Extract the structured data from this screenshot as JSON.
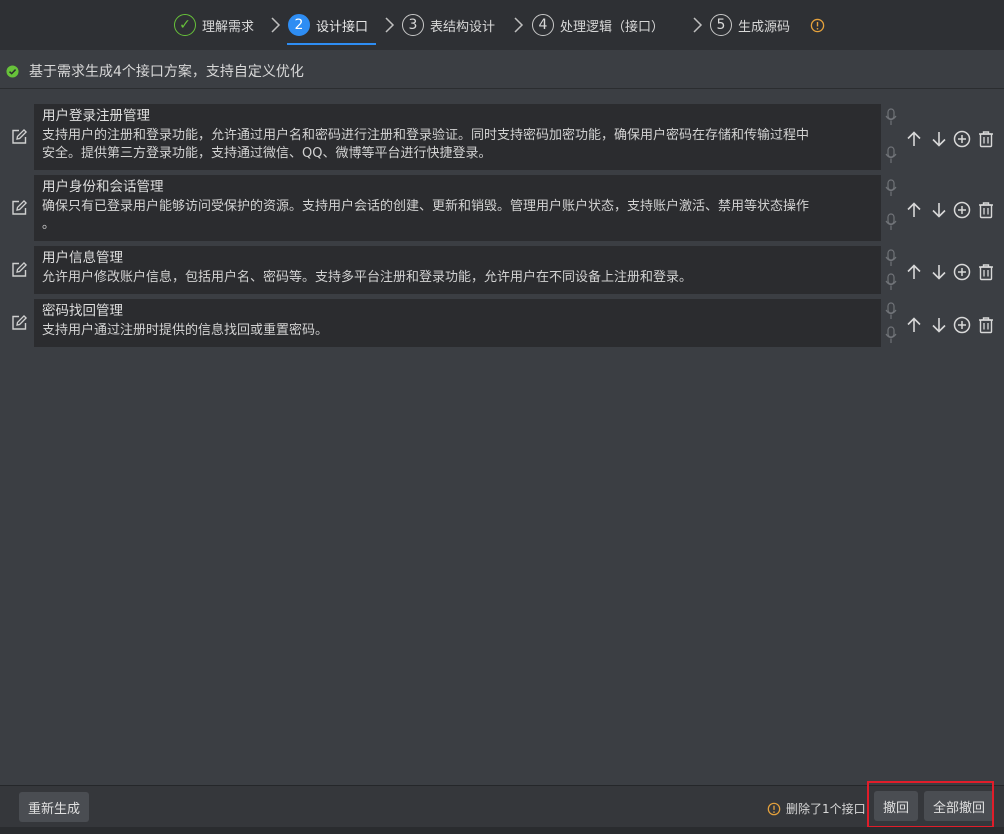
{
  "stepper": {
    "steps": [
      {
        "number": "✓",
        "label": "理解需求",
        "state": "done"
      },
      {
        "number": "2",
        "label": "设计接口",
        "state": "active"
      },
      {
        "number": "3",
        "label": "表结构设计",
        "state": "pending"
      },
      {
        "number": "4",
        "label": "处理逻辑（接口）",
        "state": "pending"
      },
      {
        "number": "5",
        "label": "生成源码",
        "state": "pending"
      }
    ],
    "info_icon": "info-circle-icon"
  },
  "notice": {
    "text": "基于需求生成4个接口方案，支持自定义优化",
    "icon": "check-circle-icon"
  },
  "items": [
    {
      "title": "用户登录注册管理",
      "desc_lines": [
        "支持用户的注册和登录功能，允许通过用户名和密码进行注册和登录验证。同时支持密码加密功能，确保用户密码在存储和传输过程中",
        "安全。提供第三方登录功能，支持通过微信、QQ、微博等平台进行快捷登录。"
      ]
    },
    {
      "title": "用户身份和会话管理",
      "desc_lines": [
        "确保只有已登录用户能够访问受保护的资源。支持用户会话的创建、更新和销毁。管理用户账户状态，支持账户激活、禁用等状态操作",
        "。"
      ]
    },
    {
      "title": "用户信息管理",
      "desc_lines": [
        "允许用户修改账户信息，包括用户名、密码等。支持多平台注册和登录功能，允许用户在不同设备上注册和登录。"
      ]
    },
    {
      "title": "密码找回管理",
      "desc_lines": [
        "支持用户通过注册时提供的信息找回或重置密码。"
      ]
    }
  ],
  "footer": {
    "regenerate_label": "重新生成",
    "status_text": "删除了1个接口",
    "undo_label": "撤回",
    "undo_all_label": "全部撤回"
  },
  "colors": {
    "accent": "#2e8df3",
    "success": "#67c23a",
    "warning": "#e6a23c",
    "highlight": "#e11d2a"
  }
}
